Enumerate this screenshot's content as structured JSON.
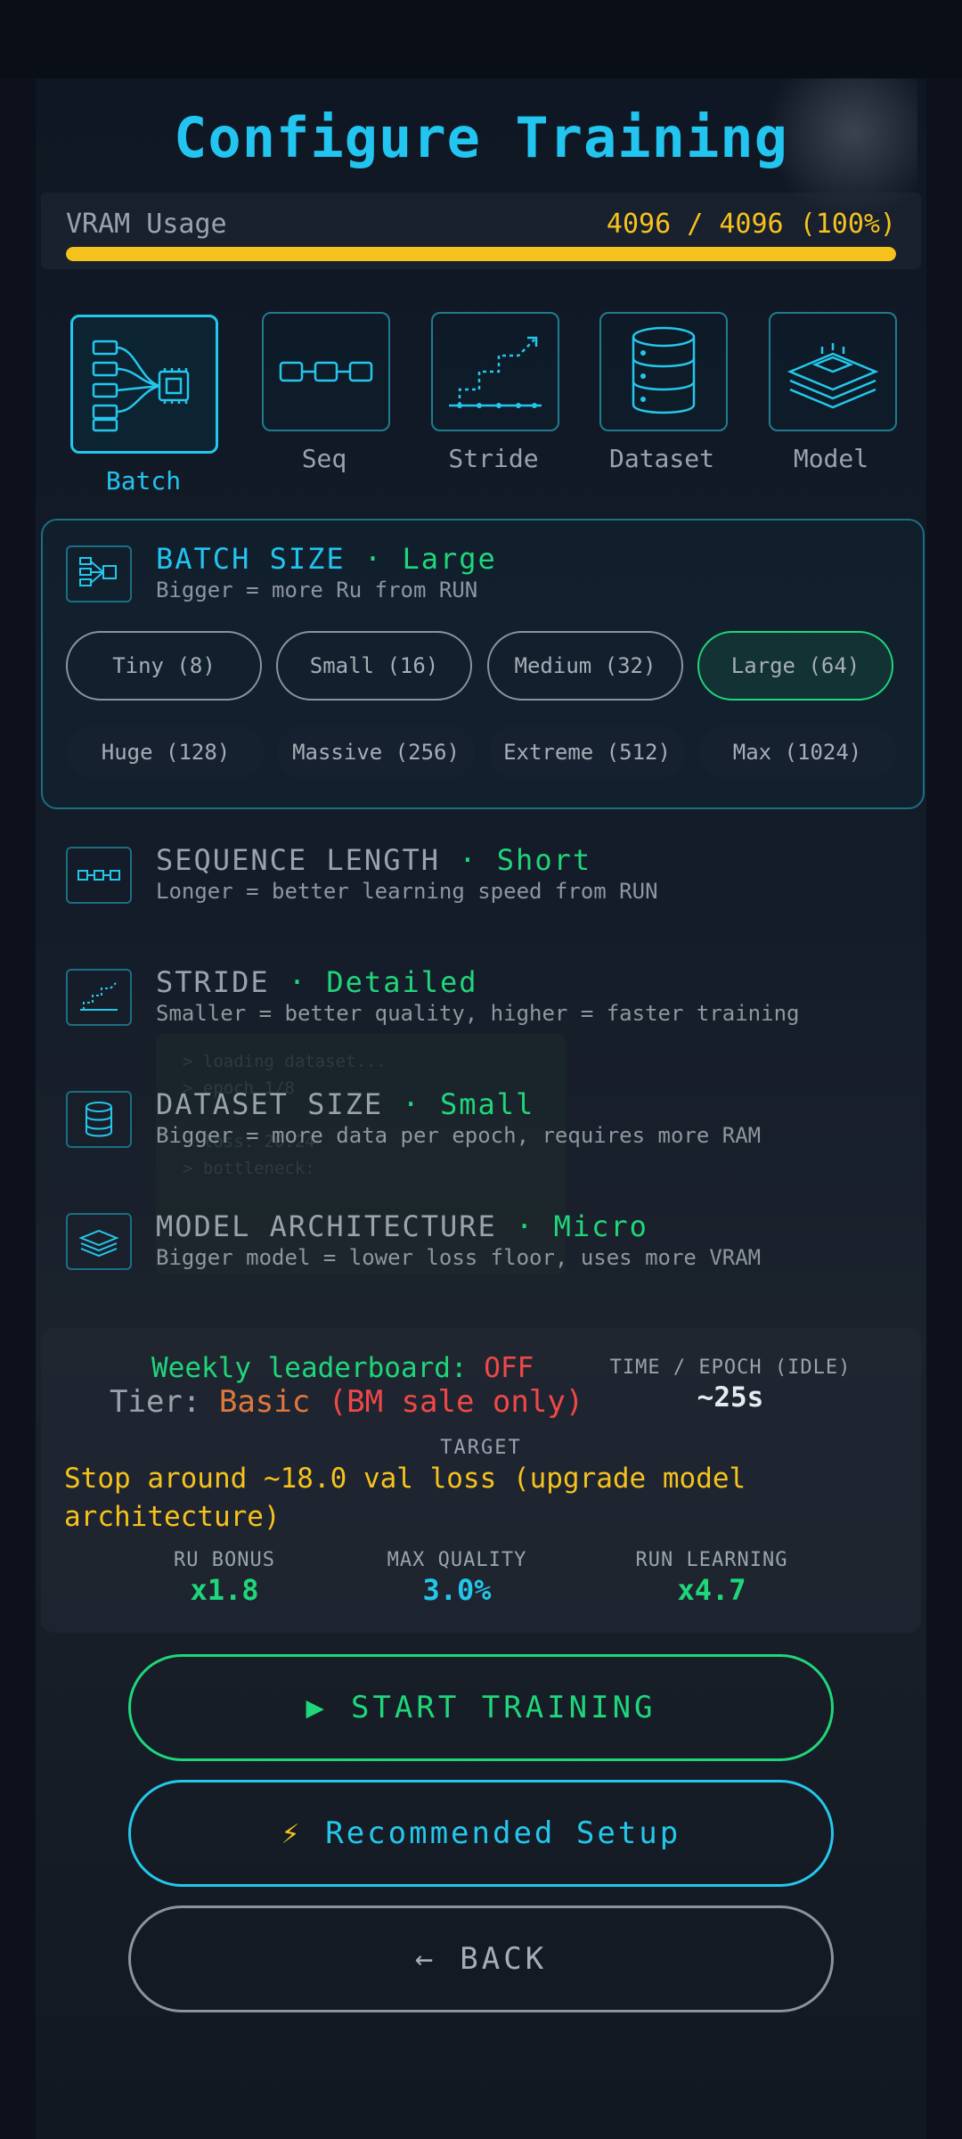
{
  "title": "Configure Training",
  "vram": {
    "label": "VRAM Usage",
    "value": "4096 / 4096 (100%)",
    "fraction": 1.0
  },
  "tabs": [
    {
      "label": "Batch",
      "icon": "batch-chip-icon",
      "active": true
    },
    {
      "label": "Seq",
      "icon": "sequence-icon",
      "active": false
    },
    {
      "label": "Stride",
      "icon": "stride-icon",
      "active": false
    },
    {
      "label": "Dataset",
      "icon": "dataset-icon",
      "active": false
    },
    {
      "label": "Model",
      "icon": "model-layers-icon",
      "active": false
    }
  ],
  "batch": {
    "title": "BATCH SIZE",
    "separator": "·",
    "value": "Large",
    "desc": "Bigger = more Ru from RUN",
    "options_row1": [
      "Tiny (8)",
      "Small (16)",
      "Medium (32)",
      "Large (64)"
    ],
    "options_row2": [
      "Huge (128)",
      "Massive (256)",
      "Extreme (512)",
      "Max (1024)"
    ],
    "selected": "Large (64)"
  },
  "sections": [
    {
      "title": "SEQUENCE LENGTH",
      "value": "Short",
      "desc": "Longer = better learning speed from RUN"
    },
    {
      "title": "STRIDE",
      "value": "Detailed",
      "desc": "Smaller = better quality, higher = faster training"
    },
    {
      "title": "DATASET SIZE",
      "value": "Small",
      "desc": "Bigger = more data per epoch, requires more RAM"
    },
    {
      "title": "MODEL ARCHITECTURE",
      "value": "Micro",
      "desc": "Bigger model = lower loss floor, uses more VRAM"
    }
  ],
  "summary": {
    "leaderboard_label": "Weekly leaderboard:",
    "leaderboard_value": "OFF",
    "tier_label": "Tier:",
    "tier_value": "Basic",
    "tier_note": "(BM sale only)",
    "time_label": "TIME / EPOCH (IDLE)",
    "time_value": "~25s",
    "target_label": "TARGET",
    "target_text": "Stop around ~18.0 val loss (upgrade model architecture)",
    "stats": [
      {
        "label": "RU BONUS",
        "value": "x1.8",
        "color": "#1fd67a"
      },
      {
        "label": "MAX QUALITY",
        "value": "3.0%",
        "color": "#24c7ec"
      },
      {
        "label": "RUN LEARNING",
        "value": "x4.7",
        "color": "#1fd67a"
      }
    ]
  },
  "buttons": {
    "start": {
      "icon": "▶",
      "label": "START TRAINING"
    },
    "recommended": {
      "icon": "⚡",
      "label": "Recommended Setup"
    },
    "back": {
      "icon": "←",
      "label": "BACK"
    }
  },
  "colors": {
    "accent_cyan": "#22c4f0",
    "accent_green": "#1fd67a",
    "warning_yellow": "#f6c21c",
    "danger_red": "#f04848"
  }
}
